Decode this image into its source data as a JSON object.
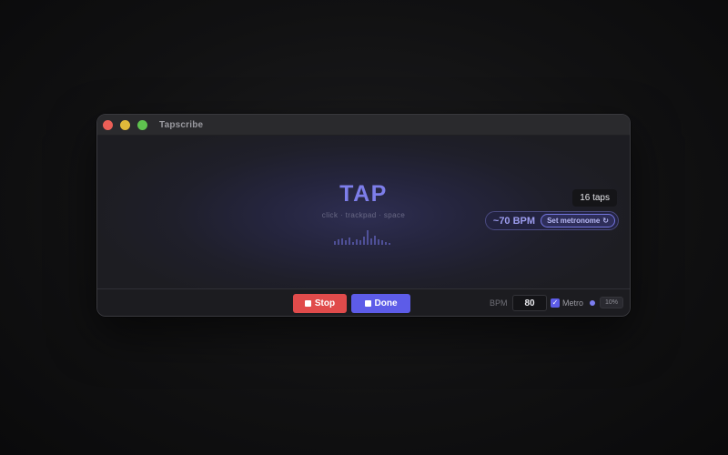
{
  "window": {
    "title": "Tapscribe"
  },
  "tap": {
    "label": "TAP",
    "hint": "click · trackpad · space",
    "meter_levels": [
      0.25,
      0.35,
      0.45,
      0.3,
      0.5,
      0.2,
      0.4,
      0.3,
      0.55,
      1.0,
      0.45,
      0.6,
      0.35,
      0.3,
      0.2,
      0.15
    ]
  },
  "status": {
    "taps": "16 taps",
    "bpm_estimate": "~70 BPM",
    "set_metronome_label": "Set metronome",
    "set_metronome_icon": "↻"
  },
  "footer": {
    "stop_label": "Stop",
    "done_label": "Done",
    "bpm_label": "BPM",
    "bpm_value": "80",
    "metro_checked": true,
    "metro_label": "Metro",
    "volume": "10%"
  },
  "colors": {
    "accent": "#5d5ce8",
    "stop": "#e04b4b",
    "tap_text": "#7d7eea"
  }
}
